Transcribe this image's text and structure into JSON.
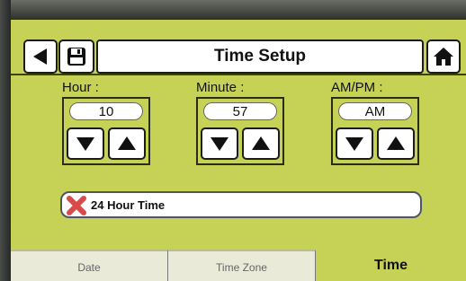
{
  "header": {
    "title": "Time Setup"
  },
  "fields": {
    "hour": {
      "label": "Hour :",
      "value": "10"
    },
    "minute": {
      "label": "Minute :",
      "value": "57"
    },
    "ampm": {
      "label": "AM/PM :",
      "value": "AM"
    }
  },
  "toggle": {
    "label": "24 Hour Time",
    "state": "off"
  },
  "tabs": {
    "date": "Date",
    "time_zone": "Time Zone",
    "time": "Time",
    "active": "Time"
  },
  "colors": {
    "screen": "#c6d255",
    "toggle_off_mark": "#d94a4a"
  },
  "icons": [
    "back-arrow-icon",
    "save-disk-icon",
    "home-icon",
    "down-arrow-icon",
    "up-arrow-icon",
    "x-mark-icon"
  ]
}
